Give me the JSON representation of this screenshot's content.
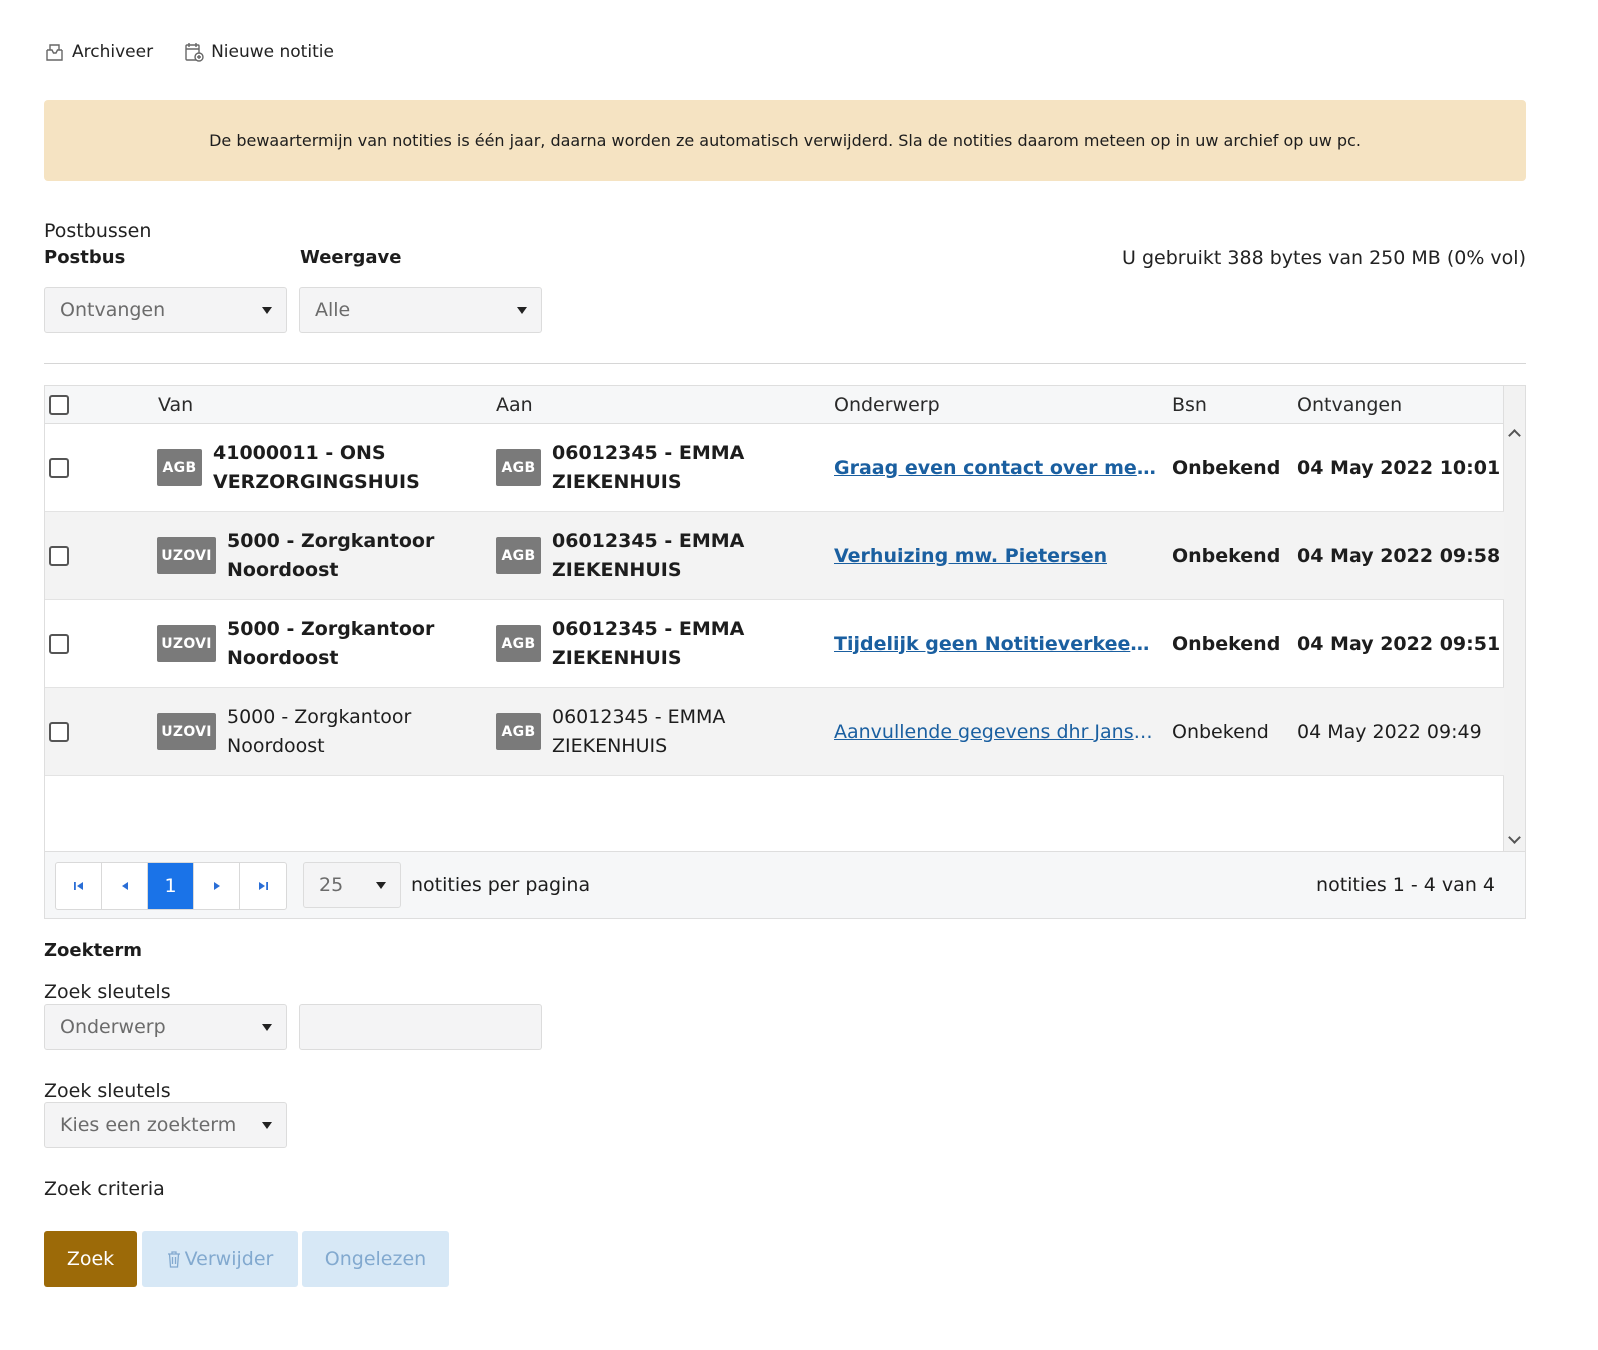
{
  "toolbar": {
    "archive_label": "Archiveer",
    "new_note_label": "Nieuwe notitie"
  },
  "notice": {
    "text": "De bewaartermijn van notities is één jaar, daarna worden ze automatisch verwijderd. Sla de notities daarom meteen op in uw archief op uw pc."
  },
  "filters": {
    "section_label": "Postbussen",
    "mailbox_label": "Postbus",
    "mailbox_value": "Ontvangen",
    "view_label": "Weergave",
    "view_value": "Alle",
    "storage_text": "U gebruikt 388 bytes van 250 MB (0% vol)"
  },
  "table": {
    "columns": {
      "from": "Van",
      "to": "Aan",
      "subject": "Onderwerp",
      "bsn": "Bsn",
      "received": "Ontvangen"
    },
    "rows": [
      {
        "from_badge": "AGB",
        "from_line1": "41000011 - ONS",
        "from_line2": "VERZORGINGSHUIS",
        "to_badge": "AGB",
        "to_line1": "06012345 - EMMA",
        "to_line2": "ZIEKENHUIS",
        "subject": "Graag even contact over mevrou...",
        "bsn": "Onbekend",
        "received": "04 May 2022 10:01",
        "unread": true
      },
      {
        "from_badge": "UZOVI",
        "from_line1": "5000 - Zorgkantoor",
        "from_line2": "Noordoost",
        "to_badge": "AGB",
        "to_line1": "06012345 - EMMA",
        "to_line2": "ZIEKENHUIS",
        "subject": "Verhuizing mw. Pietersen",
        "bsn": "Onbekend",
        "received": "04 May 2022 09:58",
        "unread": true
      },
      {
        "from_badge": "UZOVI",
        "from_line1": "5000 - Zorgkantoor",
        "from_line2": "Noordoost",
        "to_badge": "AGB",
        "to_line1": "06012345 - EMMA",
        "to_line2": "ZIEKENHUIS",
        "subject": "Tijdelijk geen Notitieverkeer mog...",
        "bsn": "Onbekend",
        "received": "04 May 2022 09:51",
        "unread": true
      },
      {
        "from_badge": "UZOVI",
        "from_line1": "5000 - Zorgkantoor",
        "from_line2": "Noordoost",
        "to_badge": "AGB",
        "to_line1": "06012345 - EMMA",
        "to_line2": "ZIEKENHUIS",
        "subject": "Aanvullende gegevens dhr Janssen",
        "bsn": "Onbekend",
        "received": "04 May 2022 09:49",
        "unread": false
      }
    ]
  },
  "pager": {
    "current_page": "1",
    "per_page": "25",
    "per_page_label": "notities per pagina",
    "count_text": "notities 1 - 4 van 4"
  },
  "search": {
    "title": "Zoekterm",
    "keys_label_1": "Zoek sleutels",
    "keys_value_1": "Onderwerp",
    "term_value": "",
    "keys_label_2": "Zoek sleutels",
    "keys_value_2": "Kies een zoekterm",
    "criteria_label": "Zoek criteria"
  },
  "actions": {
    "search_label": "Zoek",
    "delete_label": "Verwijder",
    "unread_label": "Ongelezen"
  },
  "colors": {
    "notice_bg": "#f5e3c2",
    "link": "#1a5fa0",
    "primary_button": "#9c6a08",
    "active_page": "#1a73e8",
    "badge_bg": "#7a7a7a"
  }
}
